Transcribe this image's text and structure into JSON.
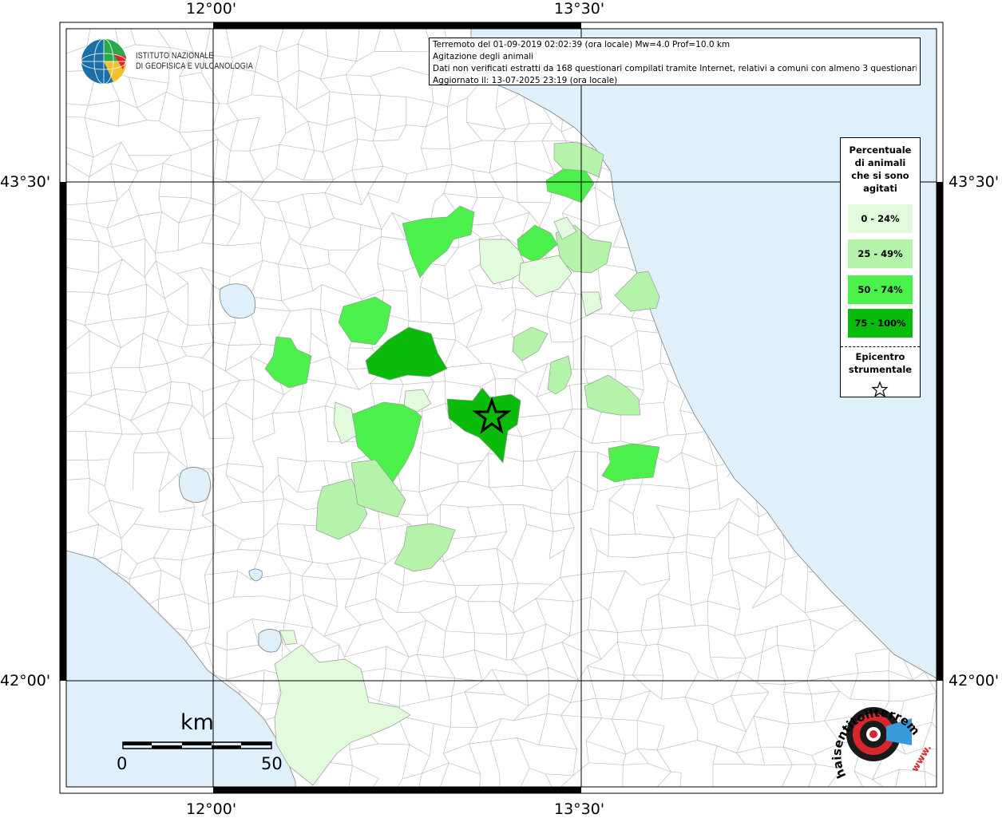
{
  "map": {
    "ticks_top": [
      "12°00'",
      "13°30'"
    ],
    "ticks_bottom": [
      "12°00'",
      "13°30'"
    ],
    "ticks_left": [
      "43°30'",
      "42°00'"
    ],
    "ticks_right": [
      "43°30'",
      "42°00'"
    ]
  },
  "info": {
    "line1": "Terremoto del 01-09-2019 02:02:39 (ora locale) Mw=4.0 Prof=10.0 km",
    "line2": "Agitazione degli animali",
    "line3": "Dati non verificati estratti da 168 questionari compilati tramite Internet, relativi a comuni con almeno 3 questionari.",
    "line4": "Aggiornato il: 13-07-2025 23:19 (ora locale)"
  },
  "logo": {
    "line1": "ISTITUTO NAZIONALE",
    "line2": "DI GEOFISICA E VULCANOLOGIA"
  },
  "legend": {
    "title1": "Percentuale",
    "title2": "di animali",
    "title3": "che si sono",
    "title4": "agitati",
    "items": [
      {
        "label": "0 - 24%",
        "color": "#e2fbdc"
      },
      {
        "label": "25 - 49%",
        "color": "#b6f3aa"
      },
      {
        "label": "50 - 74%",
        "color": "#4bf04b"
      },
      {
        "label": "75 - 100%",
        "color": "#0bbb0b"
      }
    ],
    "epicenter1": "Epicentro",
    "epicenter2": "strumentale"
  },
  "scale": {
    "title": "km",
    "left": "0",
    "right": "50"
  },
  "badge": {
    "text": "haisentitoilterremoto.it",
    "www": "www."
  },
  "colors": {
    "sea": "#dff0fb",
    "border": "#999999"
  }
}
